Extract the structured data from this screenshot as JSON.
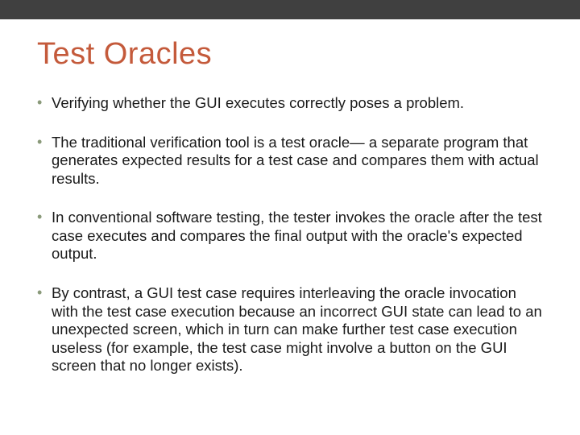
{
  "slide": {
    "title": "Test Oracles",
    "bullets": [
      "Verifying whether the GUI executes correctly poses a problem.",
      "The traditional verification tool is a test oracle— a separate program that generates expected results for a test case and compares them with actual results.",
      "In conventional software testing, the tester invokes the oracle after the test case executes and compares the final output with the oracle's expected output.",
      "By contrast, a GUI test case requires interleaving the oracle invocation with the test case execution because an incorrect GUI state can lead to an unexpected screen, which in turn can make further test case execution useless (for example, the test case might involve a button on the GUI screen that no longer exists)."
    ]
  },
  "colors": {
    "title": "#c45a3b",
    "bullet_marker": "#8a9a7a",
    "top_bar": "#404040"
  }
}
